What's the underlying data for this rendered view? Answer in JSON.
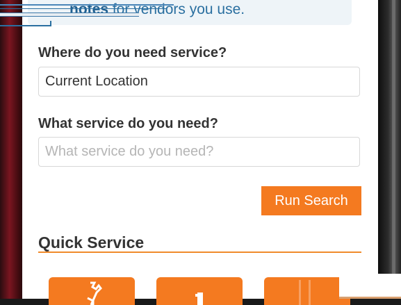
{
  "banner": {
    "text_bold": "notes",
    "text_rest": " for vendors you use."
  },
  "service_location": {
    "label": "Where do you need service?",
    "value": "Current Location"
  },
  "service_type": {
    "label": "What service do you need?",
    "placeholder": "What service do you need?"
  },
  "actions": {
    "run_search_label": "Run Search"
  },
  "quick_service": {
    "title": "Quick Service",
    "tiles": [
      {
        "icon": "wrench-icon"
      },
      {
        "icon": "bucket-icon"
      },
      {
        "icon": "tool-icon"
      }
    ]
  },
  "colors": {
    "accent": "#f47a20",
    "link": "#2a6fa0"
  }
}
